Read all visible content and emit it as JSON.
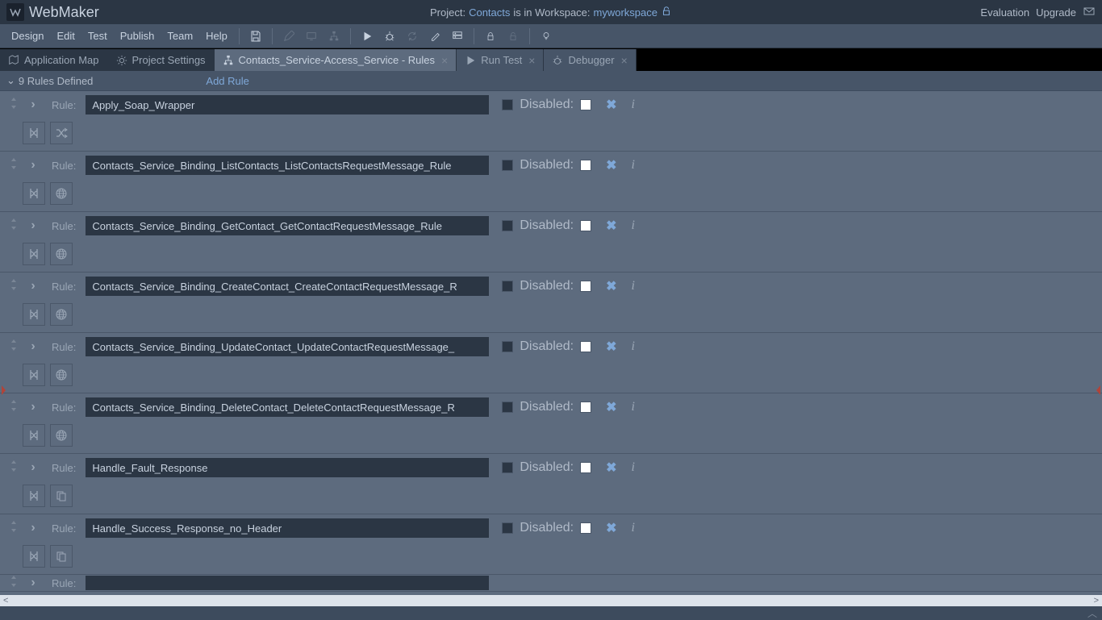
{
  "app_name": "WebMaker",
  "header": {
    "project_prefix": "Project:",
    "project_name": "Contacts",
    "workspace_join": "is in Workspace:",
    "workspace_name": "myworkspace",
    "eval": "Evaluation",
    "upgrade": "Upgrade"
  },
  "menu": [
    "Design",
    "Edit",
    "Test",
    "Publish",
    "Team",
    "Help"
  ],
  "tabs": {
    "fixed": [
      "Application Map",
      "Project Settings"
    ],
    "open": [
      {
        "label": "Contacts_Service-Access_Service - Rules",
        "active": true,
        "icon": "tree"
      },
      {
        "label": "Run Test",
        "active": false,
        "icon": "play"
      },
      {
        "label": "Debugger",
        "active": false,
        "icon": "bug"
      }
    ]
  },
  "subbar": {
    "count": "9 Rules Defined",
    "add": "Add Rule"
  },
  "labels": {
    "rule": "Rule:",
    "disabled": "Disabled:"
  },
  "rules": [
    {
      "name": "Apply_Soap_Wrapper",
      "icons": [
        "binding",
        "shuffle"
      ]
    },
    {
      "name": "Contacts_Service_Binding_ListContacts_ListContactsRequestMessage_Rule",
      "icons": [
        "binding",
        "globe"
      ]
    },
    {
      "name": "Contacts_Service_Binding_GetContact_GetContactRequestMessage_Rule",
      "icons": [
        "binding",
        "globe"
      ]
    },
    {
      "name": "Contacts_Service_Binding_CreateContact_CreateContactRequestMessage_R",
      "icons": [
        "binding",
        "globe"
      ]
    },
    {
      "name": "Contacts_Service_Binding_UpdateContact_UpdateContactRequestMessage_",
      "icons": [
        "binding",
        "globe"
      ]
    },
    {
      "name": "Contacts_Service_Binding_DeleteContact_DeleteContactRequestMessage_R",
      "icons": [
        "binding",
        "globe"
      ]
    },
    {
      "name": "Handle_Fault_Response",
      "icons": [
        "binding",
        "copy"
      ]
    },
    {
      "name": "Handle_Success_Response_no_Header",
      "icons": [
        "binding",
        "copy"
      ]
    }
  ]
}
